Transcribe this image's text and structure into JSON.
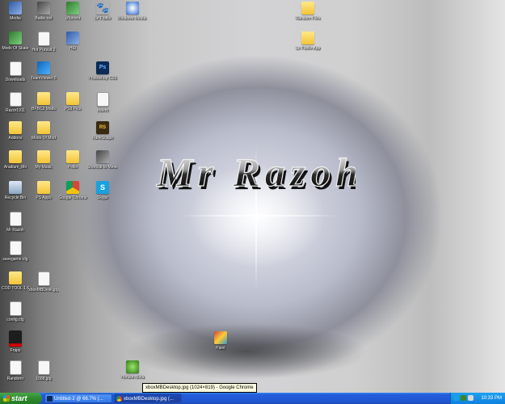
{
  "desktop": {
    "wallpaper_text": "Mr Razoh",
    "icons": [
      {
        "label": "Media",
        "type": "app"
      },
      {
        "label": "Battle.net",
        "type": "shortcut"
      },
      {
        "label": "uTorrent",
        "type": "green"
      },
      {
        "label": "Le Fluffie",
        "type": "paw"
      },
      {
        "label": "Windows Media Player",
        "type": "wmp"
      },
      {
        "label": "Mods Of Skate",
        "type": "green"
      },
      {
        "label": "Hot Pursuit 2",
        "type": "doc"
      },
      {
        "label": "HiD",
        "type": "app"
      },
      {
        "label": "Downloads",
        "type": "doc"
      },
      {
        "label": "TeamViewer 6",
        "type": "tv"
      },
      {
        "label": "Photoshop CS5",
        "type": "ps"
      },
      {
        "label": "Razor1911",
        "type": "doc"
      },
      {
        "label": "BFBC2 Mods",
        "type": "folder"
      },
      {
        "label": "PS3 Pics",
        "type": "folder"
      },
      {
        "label": "trident",
        "type": "doc"
      },
      {
        "label": "Addons",
        "type": "folder"
      },
      {
        "label": "Mods Of Mod",
        "type": "folder"
      },
      {
        "label": "RuneScape",
        "type": "rs"
      },
      {
        "label": "Aradium_Mo",
        "type": "folder"
      },
      {
        "label": "My Music",
        "type": "folder"
      },
      {
        "label": "Pellio",
        "type": "folder"
      },
      {
        "label": "Shortcut to Minecraft",
        "type": "shortcut"
      },
      {
        "label": "Recycle Bin",
        "type": "recycle"
      },
      {
        "label": "PS Apps",
        "type": "folder"
      },
      {
        "label": "Google Chrome",
        "type": "chrome"
      },
      {
        "label": "Skype",
        "type": "skype"
      },
      {
        "label": "Mr Razoh",
        "type": "doc"
      },
      {
        "label": "savegame.cfg",
        "type": "doc"
      },
      {
        "label": "COD TOOL 1.6",
        "type": "folder"
      },
      {
        "label": "xboxMBDesk.jpg",
        "type": "doc"
      },
      {
        "label": "config.cfg",
        "type": "doc"
      },
      {
        "label": "Fraps",
        "type": "red"
      },
      {
        "label": "Randomr",
        "type": "doc"
      },
      {
        "label": "1688.jpg",
        "type": "doc"
      },
      {
        "label": "Horizon Beta",
        "type": "xbox"
      },
      {
        "label": "Paint",
        "type": "paint"
      },
      {
        "label": "Random Files",
        "type": "folder"
      },
      {
        "label": "Le Fluffie App",
        "type": "folder"
      }
    ]
  },
  "tooltip": {
    "text": "xboxMBDesktop.jpg (1024×819) - Google Chrome"
  },
  "taskbar": {
    "start_label": "start",
    "tasks": [
      {
        "label": "Untitled-2 @ 66.7% (...",
        "color": "#0b2a57",
        "active": false
      },
      {
        "label": "xboxMBDesktop.jpg (...",
        "color": "#f4c20d",
        "active": true
      }
    ],
    "clock": "10:33 PM"
  }
}
